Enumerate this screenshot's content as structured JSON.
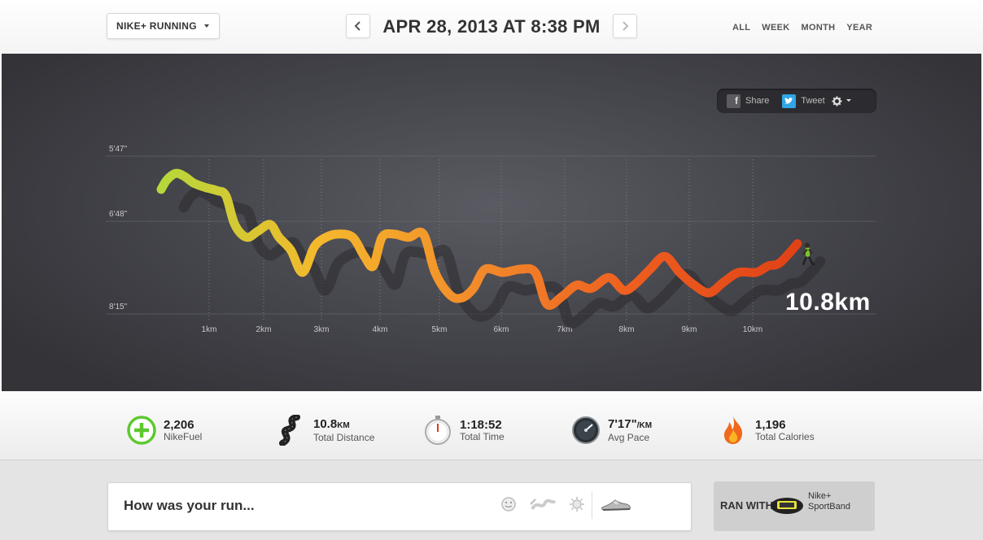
{
  "header": {
    "activity_select": "NIKE+ RUNNING",
    "date_title": "APR 28, 2013 AT 8:38 PM",
    "range_tabs": [
      "ALL",
      "WEEK",
      "MONTH",
      "YEAR"
    ]
  },
  "share": {
    "share_label": "Share",
    "tweet_label": "Tweet"
  },
  "chart_data": {
    "type": "line",
    "x_ticks": [
      "1km",
      "2km",
      "3km",
      "4km",
      "5km",
      "6km",
      "7km",
      "8km",
      "9km",
      "10km"
    ],
    "y_ticks": [
      "5'47\"",
      "6'48\"",
      "8'15\""
    ],
    "x": [
      0,
      0.1,
      0.25,
      0.4,
      0.55,
      0.75,
      0.95,
      1.1,
      1.25,
      1.45,
      1.65,
      1.85,
      2.0,
      2.2,
      2.4,
      2.6,
      2.8,
      3.0,
      3.25,
      3.45,
      3.6,
      3.75,
      3.95,
      4.2,
      4.45,
      4.65,
      4.9,
      5.1,
      5.3,
      5.5,
      5.8,
      6.1,
      6.35,
      6.55,
      6.8,
      7.05,
      7.3,
      7.6,
      7.85,
      8.05,
      8.3,
      8.55,
      8.8,
      9.05,
      9.3,
      9.55,
      9.8,
      10.1,
      10.3,
      10.5,
      10.8
    ],
    "y_pace_min": [
      6.3,
      6.15,
      6.05,
      6.1,
      6.2,
      6.27,
      6.32,
      6.4,
      6.85,
      7.05,
      6.95,
      6.85,
      7.05,
      7.25,
      7.6,
      7.2,
      7.05,
      7.0,
      7.05,
      7.35,
      7.5,
      7.05,
      7.0,
      7.05,
      7.0,
      7.6,
      7.95,
      8.0,
      7.85,
      7.55,
      7.6,
      7.55,
      7.6,
      8.1,
      7.98,
      7.8,
      7.85,
      7.68,
      7.88,
      7.78,
      7.55,
      7.35,
      7.6,
      7.8,
      7.92,
      7.75,
      7.6,
      7.6,
      7.5,
      7.45,
      7.15
    ],
    "ylim": [
      5.78,
      8.25
    ],
    "xlim": [
      0,
      10.8
    ],
    "series_colors": [
      "#b6d83a",
      "#f5b82c",
      "#f28a2a",
      "#ed5d1f",
      "#e04216"
    ],
    "end_label": "10.8km"
  },
  "stats": [
    {
      "icon": "nikefuel-icon",
      "value": "2,206",
      "unit": "",
      "label": "NikeFuel"
    },
    {
      "icon": "road-icon",
      "value": "10.8",
      "unit": "KM",
      "label": "Total Distance"
    },
    {
      "icon": "stopwatch-icon",
      "value": "1:18:52",
      "unit": "",
      "label": "Total Time"
    },
    {
      "icon": "speedometer-icon",
      "value": "7'17\"",
      "unit": "/KM",
      "label": "Avg Pace"
    },
    {
      "icon": "flame-icon",
      "value": "1,196",
      "unit": "",
      "label": "Total Calories"
    }
  ],
  "feedback": {
    "prompt": "How was your run..."
  },
  "ran_with": {
    "label": "RAN WITH",
    "device_line1": "Nike+",
    "device_line2": "SportBand"
  }
}
